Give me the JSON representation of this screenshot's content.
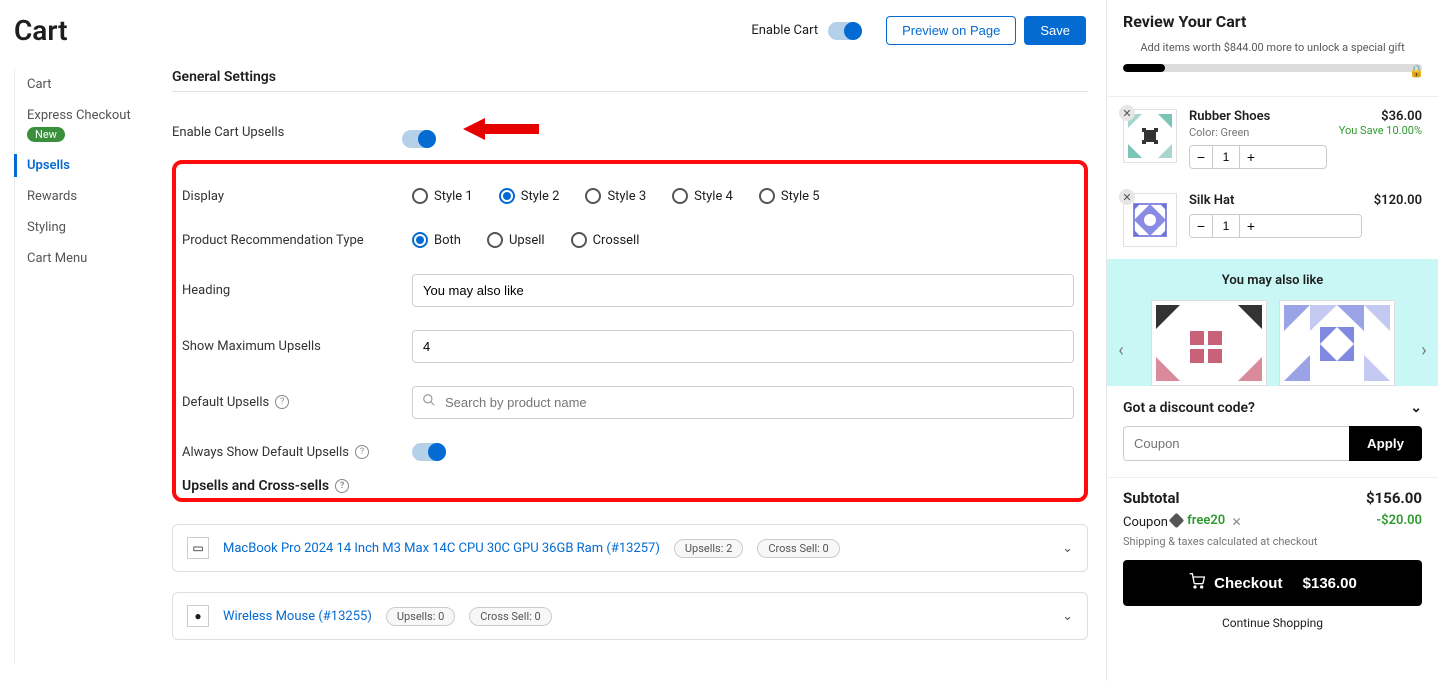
{
  "header": {
    "title": "Cart",
    "enable_label": "Enable Cart",
    "preview_label": "Preview on Page",
    "save_label": "Save"
  },
  "sidebar": {
    "items": [
      {
        "label": "Cart"
      },
      {
        "label": "Express Checkout",
        "badge": "New"
      },
      {
        "label": "Upsells"
      },
      {
        "label": "Rewards"
      },
      {
        "label": "Styling"
      },
      {
        "label": "Cart Menu"
      }
    ]
  },
  "settings": {
    "section_title": "General Settings",
    "enable_upsells_label": "Enable Cart Upsells",
    "display_label": "Display",
    "display_options": [
      "Style 1",
      "Style 2",
      "Style 3",
      "Style 4",
      "Style 5"
    ],
    "rec_type_label": "Product Recommendation Type",
    "rec_type_options": [
      "Both",
      "Upsell",
      "Crossell"
    ],
    "heading_label": "Heading",
    "heading_value": "You may also like",
    "max_label": "Show Maximum Upsells",
    "max_value": "4",
    "default_upsells_label": "Default Upsells",
    "default_upsells_placeholder": "Search by product name",
    "always_show_label": "Always Show Default Upsells",
    "sub_section_title": "Upsells and Cross-sells"
  },
  "products": [
    {
      "name": "MacBook Pro 2024 14 Inch M3 Max 14C CPU 30C GPU 36GB Ram (#13257)",
      "upsells": "Upsells: 2",
      "crosssell": "Cross Sell: 0"
    },
    {
      "name": "Wireless Mouse (#13255)",
      "upsells": "Upsells: 0",
      "crosssell": "Cross Sell: 0"
    }
  ],
  "cart": {
    "title": "Review Your Cart",
    "promo": "Add items worth $844.00 more to unlock a special gift",
    "items": [
      {
        "name": "Rubber Shoes",
        "variant": "Color: Green",
        "price": "$36.00",
        "save": "You Save 10.00%",
        "qty": "1"
      },
      {
        "name": "Silk Hat",
        "variant": "",
        "price": "$120.00",
        "save": "",
        "qty": "1"
      }
    ],
    "upsell_title": "You may also like",
    "discount_label": "Got a discount code?",
    "coupon_placeholder": "Coupon",
    "apply_label": "Apply",
    "subtotal_label": "Subtotal",
    "subtotal_value": "$156.00",
    "coupon_label": "Coupon",
    "coupon_code": "free20",
    "coupon_value": "-$20.00",
    "shipping_note": "Shipping & taxes calculated at checkout",
    "checkout_label": "Checkout",
    "checkout_amount": "$136.00",
    "continue_label": "Continue Shopping"
  }
}
